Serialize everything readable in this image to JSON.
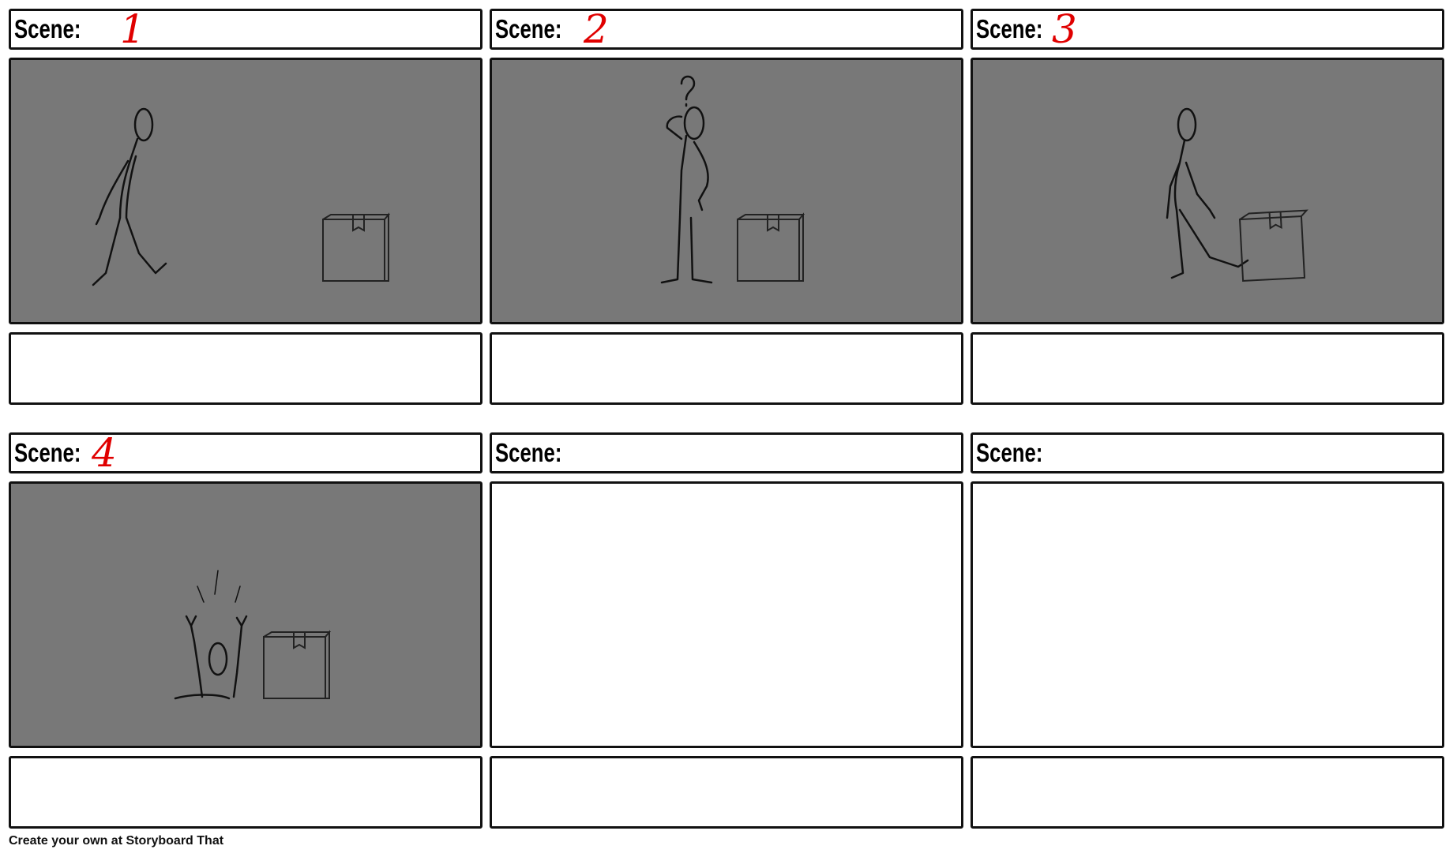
{
  "scenes": [
    {
      "label": "Scene:",
      "number": "1",
      "filled": true
    },
    {
      "label": "Scene:",
      "number": "2",
      "filled": true
    },
    {
      "label": "Scene:",
      "number": "3",
      "filled": true
    },
    {
      "label": "Scene:",
      "number": "4",
      "filled": true
    },
    {
      "label": "Scene:",
      "number": "",
      "filled": false
    },
    {
      "label": "Scene:",
      "number": "",
      "filled": false
    }
  ],
  "footer": {
    "text": "Create your own at Storyboard That"
  },
  "colors": {
    "panel_gray": "#787878",
    "number_red": "#e00000",
    "border": "#111111"
  },
  "icons": [
    "stick-figure-walking",
    "stick-figure-puzzled",
    "stick-figure-kicking",
    "stick-figure-falling-in-hole",
    "cardboard-box",
    "question-mark"
  ]
}
